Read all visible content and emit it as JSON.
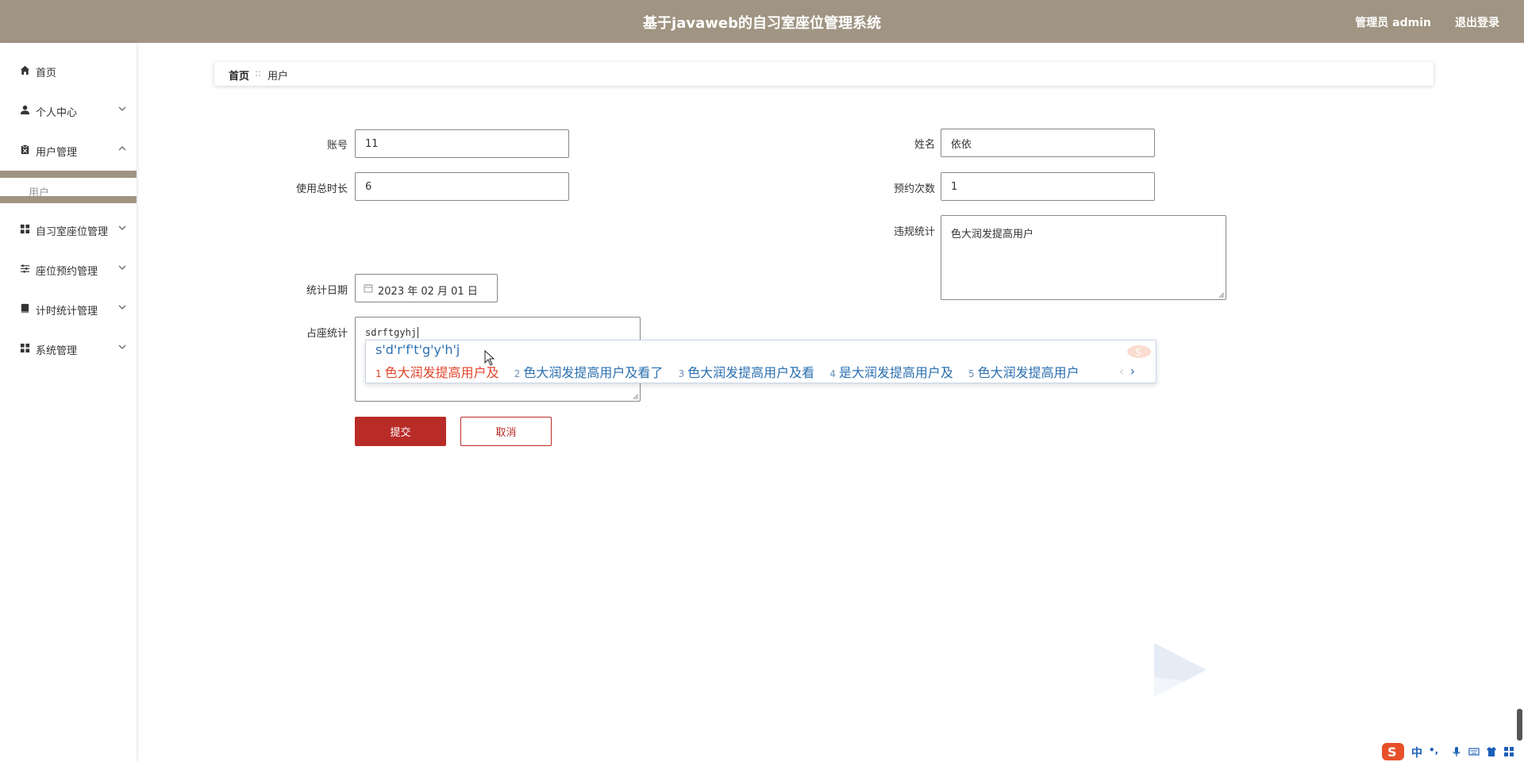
{
  "header": {
    "title": "基于javaweb的自习室座位管理系统",
    "admin_label": "管理员 admin",
    "logout_label": "退出登录"
  },
  "sidebar": {
    "items": [
      {
        "label": "首页",
        "icon": "home-icon"
      },
      {
        "label": "个人中心",
        "icon": "user-icon"
      },
      {
        "label": "用户管理",
        "icon": "clipboard-icon"
      },
      {
        "label": "自习室座位管理",
        "icon": "grid-icon"
      },
      {
        "label": "座位预约管理",
        "icon": "sliders-icon"
      },
      {
        "label": "计时统计管理",
        "icon": "book-icon"
      },
      {
        "label": "系统管理",
        "icon": "grid-icon"
      }
    ],
    "submenu_item": "用户"
  },
  "breadcrumb": {
    "home": "首页",
    "separator": "::",
    "current": "用户"
  },
  "form": {
    "account_label": "账号",
    "account_value": "11",
    "name_label": "姓名",
    "name_value": "依依",
    "total_time_label": "使用总时长",
    "total_time_value": "6",
    "reserve_count_label": "预约次数",
    "reserve_count_value": "1",
    "violation_label": "违规统计",
    "violation_value": "色大润发提高用户",
    "date_label": "统计日期",
    "date_value": "2023 年 02 月 01 日",
    "occupancy_label": "占座统计",
    "occupancy_value": "sdrftgyhj",
    "submit_label": "提交",
    "cancel_label": "取消"
  },
  "ime": {
    "composing": "s'd'r'f't'g'y'h'j",
    "candidates": [
      {
        "num": "1",
        "text": "色大润发提高用户及"
      },
      {
        "num": "2",
        "text": "色大润发提高用户及看了"
      },
      {
        "num": "3",
        "text": "色大润发提高用户及看"
      },
      {
        "num": "4",
        "text": "是大润发提高用户及"
      },
      {
        "num": "5",
        "text": "色大润发提高用户"
      }
    ],
    "next": "›",
    "prev": "‹"
  },
  "tray": {
    "lang": "中",
    "punct": "•,"
  },
  "colors": {
    "header_bg": "#a09482",
    "accent": "#b92b27"
  }
}
